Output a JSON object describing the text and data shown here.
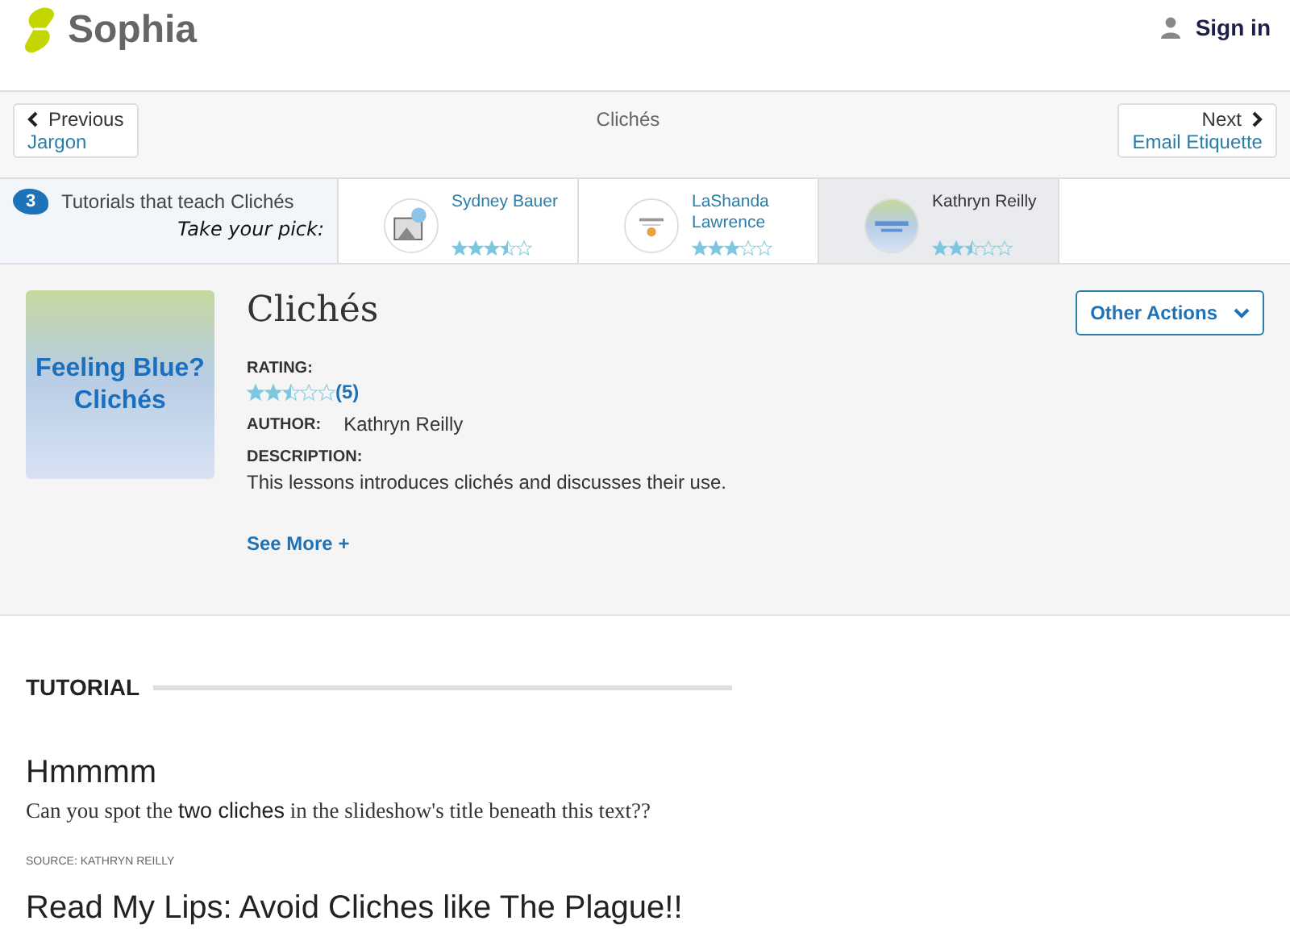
{
  "header": {
    "logo": "Sophia",
    "sign_in": "Sign in"
  },
  "nav": {
    "previous": {
      "label": "Previous",
      "title": "Jargon"
    },
    "current": "Clichés",
    "next": {
      "label": "Next",
      "title": "Email Etiquette"
    }
  },
  "tutorials": {
    "count": "3",
    "label": "Tutorials that teach Clichés",
    "pick": "Take your pick:",
    "items": [
      {
        "author": "Sydney Bauer",
        "stars": 3.5,
        "selected": false
      },
      {
        "author": "LaShanda Lawrence",
        "stars": 3,
        "selected": false
      },
      {
        "author": "Kathryn Reilly",
        "stars": 2.5,
        "selected": true
      }
    ]
  },
  "lesson": {
    "thumbnail_text": "Feeling Blue? Clichés",
    "title": "Clichés",
    "other_actions": "Other Actions",
    "rating_label": "RATING:",
    "stars": 2.5,
    "rating_count": "(5)",
    "author_label": "AUTHOR:",
    "author": "Kathryn Reilly",
    "description_label": "DESCRIPTION:",
    "description": "This lessons introduces clichés and discusses their use.",
    "see_more": "See More +"
  },
  "content": {
    "section": "TUTORIAL",
    "heading": "Hmmmm",
    "text": "Can you spot the **two cliches** in the slideshow's title beneath this text??",
    "source": "SOURCE: KATHRYN REILLY",
    "next_heading": "Read My Lips: Avoid Cliches like The Plague!!"
  }
}
